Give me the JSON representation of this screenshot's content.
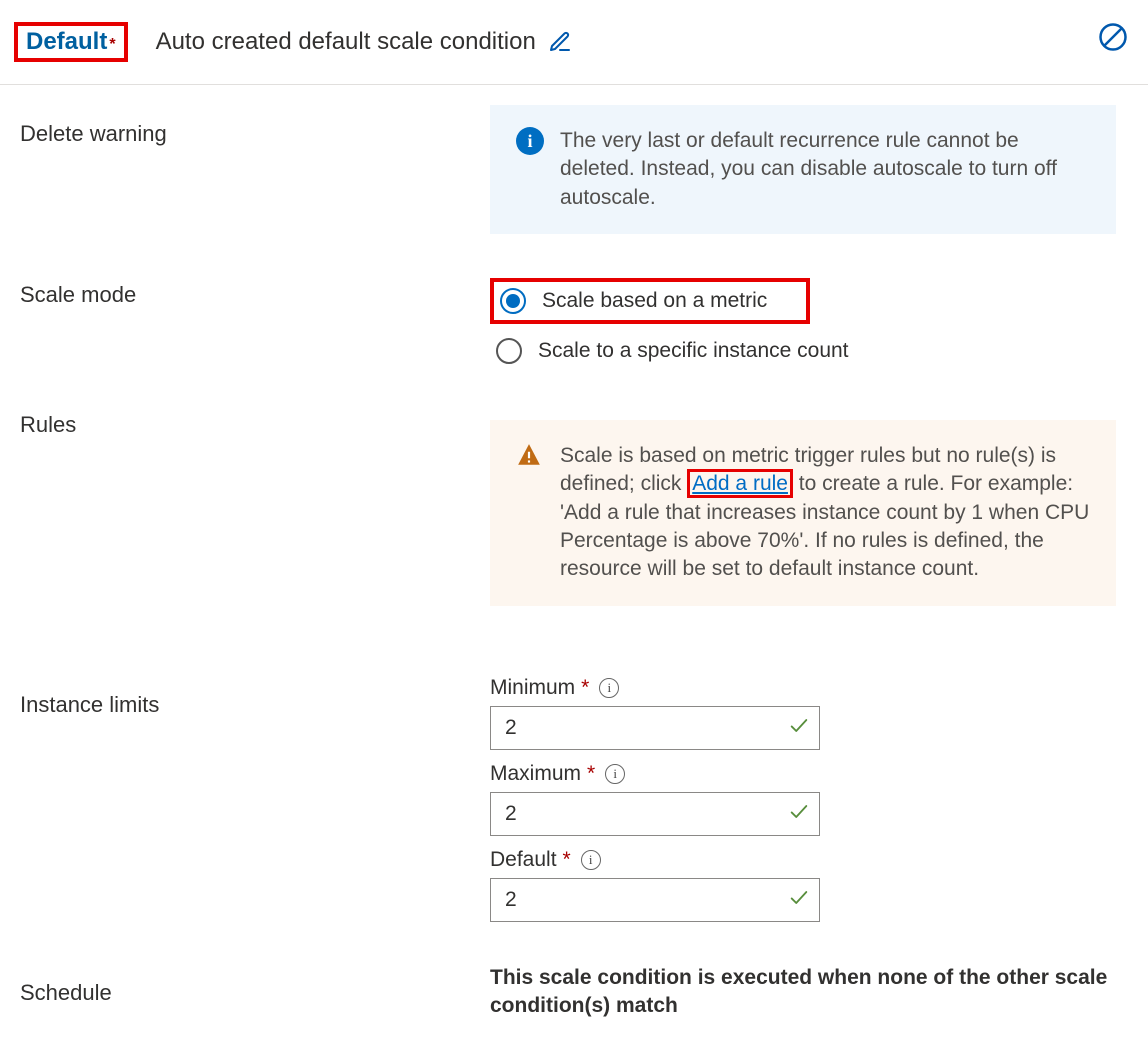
{
  "header": {
    "badge_label": "Default",
    "title": "Auto created default scale condition"
  },
  "sections": {
    "delete_warning": {
      "label": "Delete warning"
    },
    "scale_mode": {
      "label": "Scale mode"
    },
    "rules": {
      "label": "Rules"
    },
    "instance_limits": {
      "label": "Instance limits"
    },
    "schedule": {
      "label": "Schedule"
    }
  },
  "delete_warning_box": {
    "text": "The very last or default recurrence rule cannot be deleted. Instead, you can disable autoscale to turn off autoscale."
  },
  "scale_mode_options": {
    "metric": "Scale based on a metric",
    "count": "Scale to a specific instance count"
  },
  "rules_warning": {
    "text_before": "Scale is based on metric trigger rules but no rule(s) is defined; click ",
    "link_text": "Add a rule",
    "text_after": " to create a rule. For example: 'Add a rule that increases instance count by 1 when CPU Percentage is above 70%'. If no rules is defined, the resource will be set to default instance count."
  },
  "instance_limits": {
    "minimum_label": "Minimum",
    "minimum_value": "2",
    "maximum_label": "Maximum",
    "maximum_value": "2",
    "default_label": "Default",
    "default_value": "2"
  },
  "schedule_text": "This scale condition is executed when none of the other scale condition(s) match"
}
